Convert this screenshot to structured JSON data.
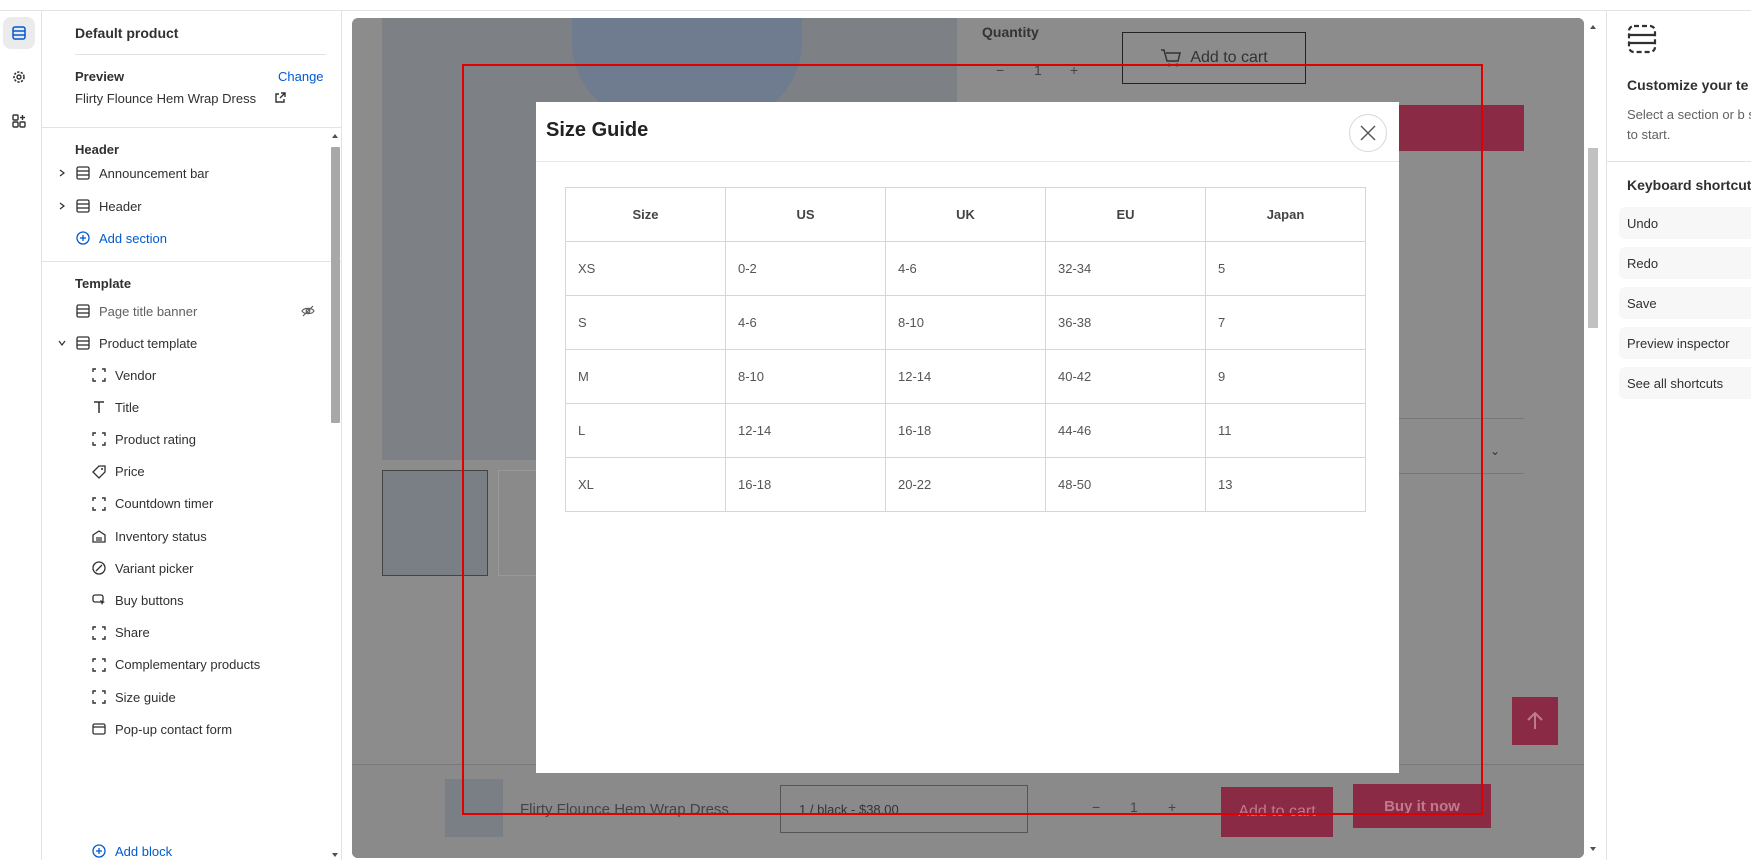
{
  "sidebar": {
    "title": "Default product",
    "preview_label": "Preview",
    "change_link": "Change",
    "preview_product": "Flirty Flounce Hem Wrap Dress",
    "header_group_label": "Header",
    "header_items": [
      "Announcement bar",
      "Header"
    ],
    "add_section": "Add section",
    "template_group_label": "Template",
    "page_title_banner": "Page title banner",
    "product_template": "Product template",
    "blocks": [
      "Vendor",
      "Title",
      "Product rating",
      "Price",
      "Countdown timer",
      "Inventory status",
      "Variant picker",
      "Buy buttons",
      "Share",
      "Complementary products",
      "Size guide",
      "Pop-up contact form"
    ],
    "add_block": "Add block"
  },
  "preview": {
    "quantity_label": "Quantity",
    "qty_value": "1",
    "add_to_cart": "Add to cart",
    "sticky": {
      "product_name": "Flirty Flounce Hem Wrap Dress",
      "variant": "1 / black - $38.00",
      "qty_value": "1",
      "add_to_cart": "Add to cart",
      "buy_now": "Buy it now"
    }
  },
  "modal": {
    "title": "Size Guide",
    "headers": [
      "Size",
      "US",
      "UK",
      "EU",
      "Japan"
    ],
    "rows": [
      [
        "XS",
        "0-2",
        "4-6",
        "32-34",
        "5"
      ],
      [
        "S",
        "4-6",
        "8-10",
        "36-38",
        "7"
      ],
      [
        "M",
        "8-10",
        "12-14",
        "40-42",
        "9"
      ],
      [
        "L",
        "12-14",
        "16-18",
        "44-46",
        "11"
      ],
      [
        "XL",
        "16-18",
        "20-22",
        "48-50",
        "13"
      ]
    ]
  },
  "right_panel": {
    "title": "Customize your te",
    "desc": "Select a section or b sidebar to start.",
    "shortcuts_title": "Keyboard shortcut",
    "shortcuts": [
      "Undo",
      "Redo",
      "Save",
      "Preview inspector",
      "See all shortcuts"
    ]
  },
  "colors": {
    "accent_blue": "#005bd3",
    "brand_pink": "#c8274f",
    "highlight_red": "#e00000"
  }
}
